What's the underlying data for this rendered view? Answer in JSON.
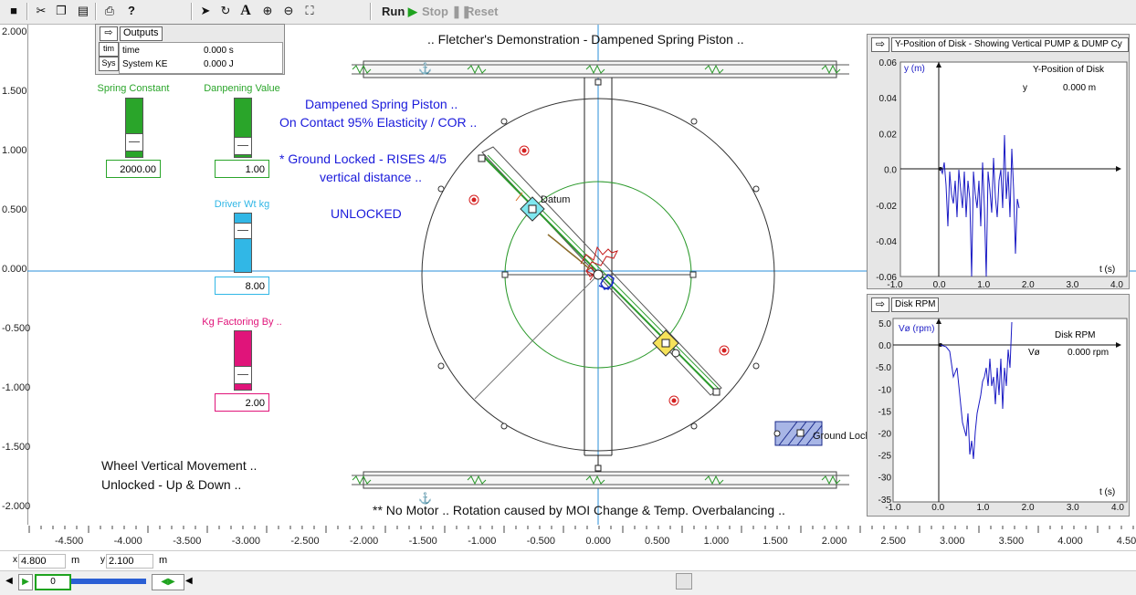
{
  "toolbar": {
    "run_label": "Run",
    "stop_label": "Stop",
    "reset_label": "Reset"
  },
  "outputs": {
    "title": "Outputs",
    "tab_time": "tim",
    "tab_sys": "Sys",
    "rows": [
      {
        "name": "time",
        "value": "0.000 s"
      },
      {
        "name": "System KE",
        "value": "0.000 J"
      }
    ]
  },
  "y_axis_ticks": [
    "2.000",
    "1.500",
    "1.000",
    "0.500",
    "0.000",
    "-0.500",
    "-1.000",
    "-1.500",
    "-2.000"
  ],
  "x_axis_ticks": [
    "-4.500",
    "-4.000",
    "-3.500",
    "-3.000",
    "-2.500",
    "-2.000",
    "-1.500",
    "-1.000",
    "-0.500",
    "0.000",
    "0.500",
    "1.000",
    "1.500",
    "2.000",
    "2.500",
    "3.000",
    "3.500",
    "4.000",
    "4.50"
  ],
  "sliders": [
    {
      "label": "Spring Constant",
      "value": "2000.00",
      "color": "#2aa52a",
      "fill": 0.55
    },
    {
      "label": "Danpening Value",
      "value": "1.00",
      "color": "#2aa52a",
      "fill": 0.55
    },
    {
      "label": "Driver Wt kg",
      "value": "8.00",
      "color": "#31b7e6",
      "fill": 0.7
    },
    {
      "label": "Kg Factoring By ..",
      "value": "2.00",
      "color": "#e0147a",
      "fill": 0.45
    }
  ],
  "scene": {
    "title": ".. Fletcher's Demonstration - Dampened Spring Piston ..",
    "notes": {
      "line1": "Dampened Spring Piston ..",
      "line2": "On Contact 95% Elasticity / COR ..",
      "line3": "* Ground Locked - RISES 4/5",
      "line4": "vertical distance ..",
      "line5": "UNLOCKED"
    },
    "wheel_text1": "Wheel Vertical Movement ..",
    "wheel_text2": "Unlocked - Up & Down ..",
    "footer": "** No Motor .. Rotation caused by MOI Change & Temp. Overbalancing ..",
    "datum_label": "Datum",
    "ground_lock_label": "Ground Lock"
  },
  "graph_y": {
    "title": "Y-Position of Disk - Showing Vertical PUMP & DUMP Cy",
    "ylabel": "y (m)",
    "xlabel": "t (s)",
    "legend_title": "Y-Position of Disk",
    "legend_var": "y",
    "legend_value": "0.000 m",
    "yticks": [
      "0.06",
      "0.04",
      "0.02",
      "0.0",
      "-0.02",
      "-0.04",
      "-0.06"
    ],
    "xticks": [
      "-1.0",
      "0.0",
      "1.0",
      "2.0",
      "3.0",
      "4.0"
    ]
  },
  "graph_rpm": {
    "title": "Disk RPM",
    "ylabel": "Vø (rpm)",
    "xlabel": "t (s)",
    "legend_title": "Disk RPM",
    "legend_var": "Vø",
    "legend_value": "0.000 rpm",
    "yticks": [
      "5.0",
      "0.0",
      "-5.0",
      "-10",
      "-15",
      "-20",
      "-25",
      "-30",
      "-35"
    ],
    "xticks": [
      "-1.0",
      "0.0",
      "1.0",
      "2.0",
      "3.0",
      "4.0"
    ]
  },
  "status": {
    "x_label": "x",
    "x_value": "4.800",
    "x_unit": "m",
    "y_label": "y",
    "y_value": "2.100",
    "y_unit": "m"
  },
  "playback": {
    "frame": "0"
  }
}
